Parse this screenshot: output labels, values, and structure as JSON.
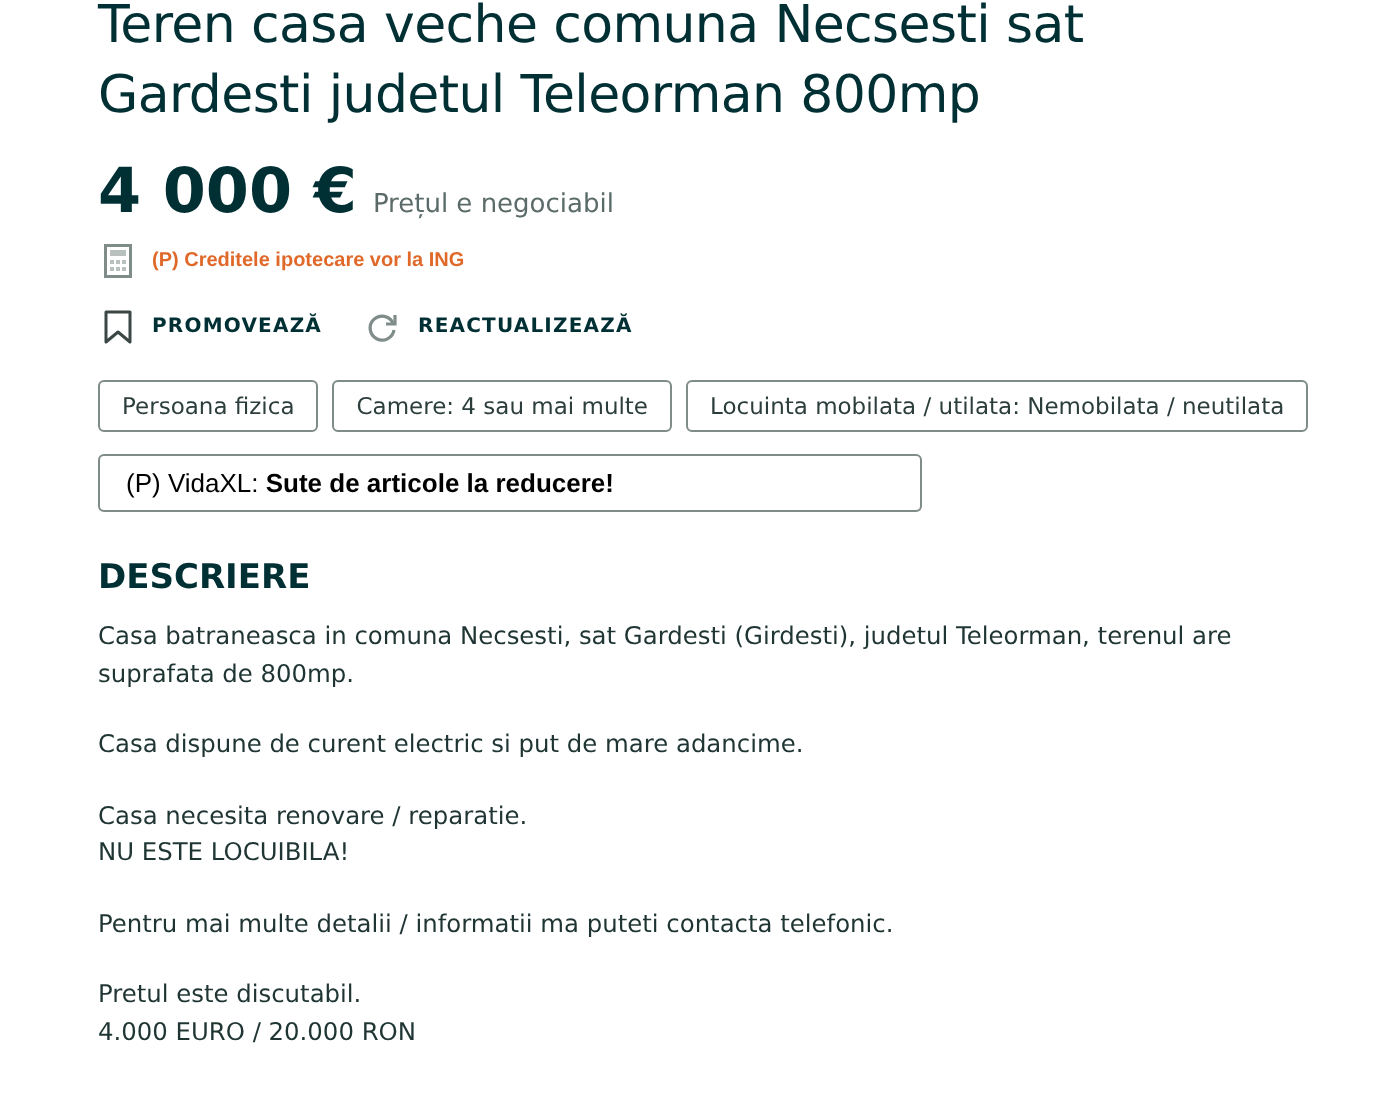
{
  "title": "Teren casa veche comuna Necsesti sat Gardesti judetul Teleorman 800mp",
  "price": {
    "amount": "4 000 €",
    "note": "Prețul e negociabil"
  },
  "credit_link": "(P) Creditele ipotecare vor la ING",
  "actions": [
    {
      "kind": "promote",
      "label": "PROMOVEAZĂ"
    },
    {
      "kind": "refresh",
      "label": "REACTUALIZEAZĂ"
    }
  ],
  "tags": [
    "Persoana fizica",
    "Camere: 4 sau mai multe",
    "Locuinta mobilata / utilata: Nemobilata / neutilata"
  ],
  "ad": "(P) VidaXL: **Sute de articole la reducere!**",
  "description": {
    "heading": "DESCRIERE",
    "paragraphs": [
      [
        "Casa batraneasca in comuna Necsesti, sat Gardesti (Girdesti), judetul Teleorman, terenul are suprafata de 800mp."
      ],
      [
        "Casa dispune de curent electric si put de mare adancime."
      ],
      [
        "Casa necesita renovare / reparatie.",
        "NU ESTE LOCUIBILA!"
      ],
      [
        "Pentru mai multe detalii / informatii ma puteti contacta telefonic."
      ],
      [
        "Pretul este discutabil.",
        "4.000 EURO / 20.000 RON"
      ]
    ]
  }
}
